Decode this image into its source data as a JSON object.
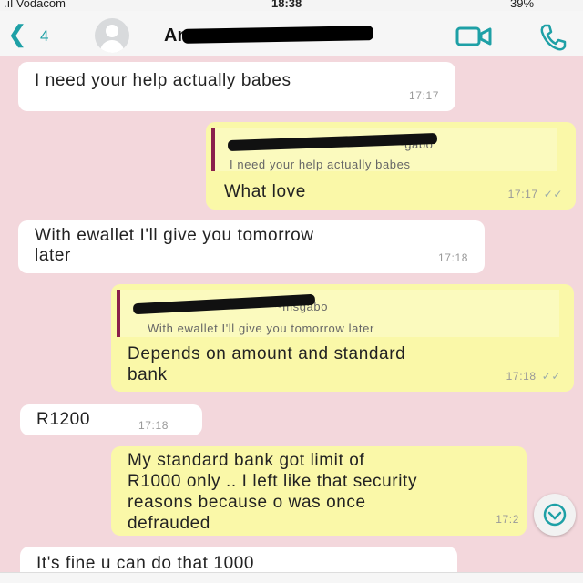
{
  "status_bar": {
    "carrier": ".ıl Vodacom",
    "time": "18:38",
    "battery": "39%"
  },
  "header": {
    "back_count": "4",
    "contact_name": "An"
  },
  "messages": [
    {
      "direction": "in",
      "text": "I need your help actually babes",
      "time": "17:17"
    },
    {
      "direction": "out",
      "quote_author": "~gabo",
      "quote_text": "I need your help actually babes",
      "text": "What love",
      "time": "17:17"
    },
    {
      "direction": "in",
      "text_line1": "With ewallet I'll give you tomorrow",
      "text_line2": "later",
      "time": "17:18"
    },
    {
      "direction": "out",
      "quote_author": "~msgabo",
      "quote_text": "With ewallet I'll give you tomorrow later",
      "text_line1": "Depends on amount and standard",
      "text_line2": "bank",
      "time": "17:18"
    },
    {
      "direction": "in",
      "text": "R1200",
      "time": "17:18"
    },
    {
      "direction": "out",
      "text_line1": "My standard bank got limit of",
      "text_line2": "R1000 only .. I left like that security",
      "text_line3": "reasons because o was once",
      "text_line4": "defrauded",
      "time": "17:2"
    },
    {
      "direction": "in",
      "text": "It's fine u can do that 1000"
    }
  ],
  "colors": {
    "background": "#f3d7dc",
    "outgoing_bubble": "#faf8a8",
    "incoming_bubble": "#ffffff",
    "accent": "#1ea0a6",
    "quote_bar": "#8a1f4b"
  },
  "icons": [
    "back-chevron-icon",
    "avatar-placeholder-icon",
    "video-call-icon",
    "phone-call-icon",
    "scroll-down-icon"
  ]
}
